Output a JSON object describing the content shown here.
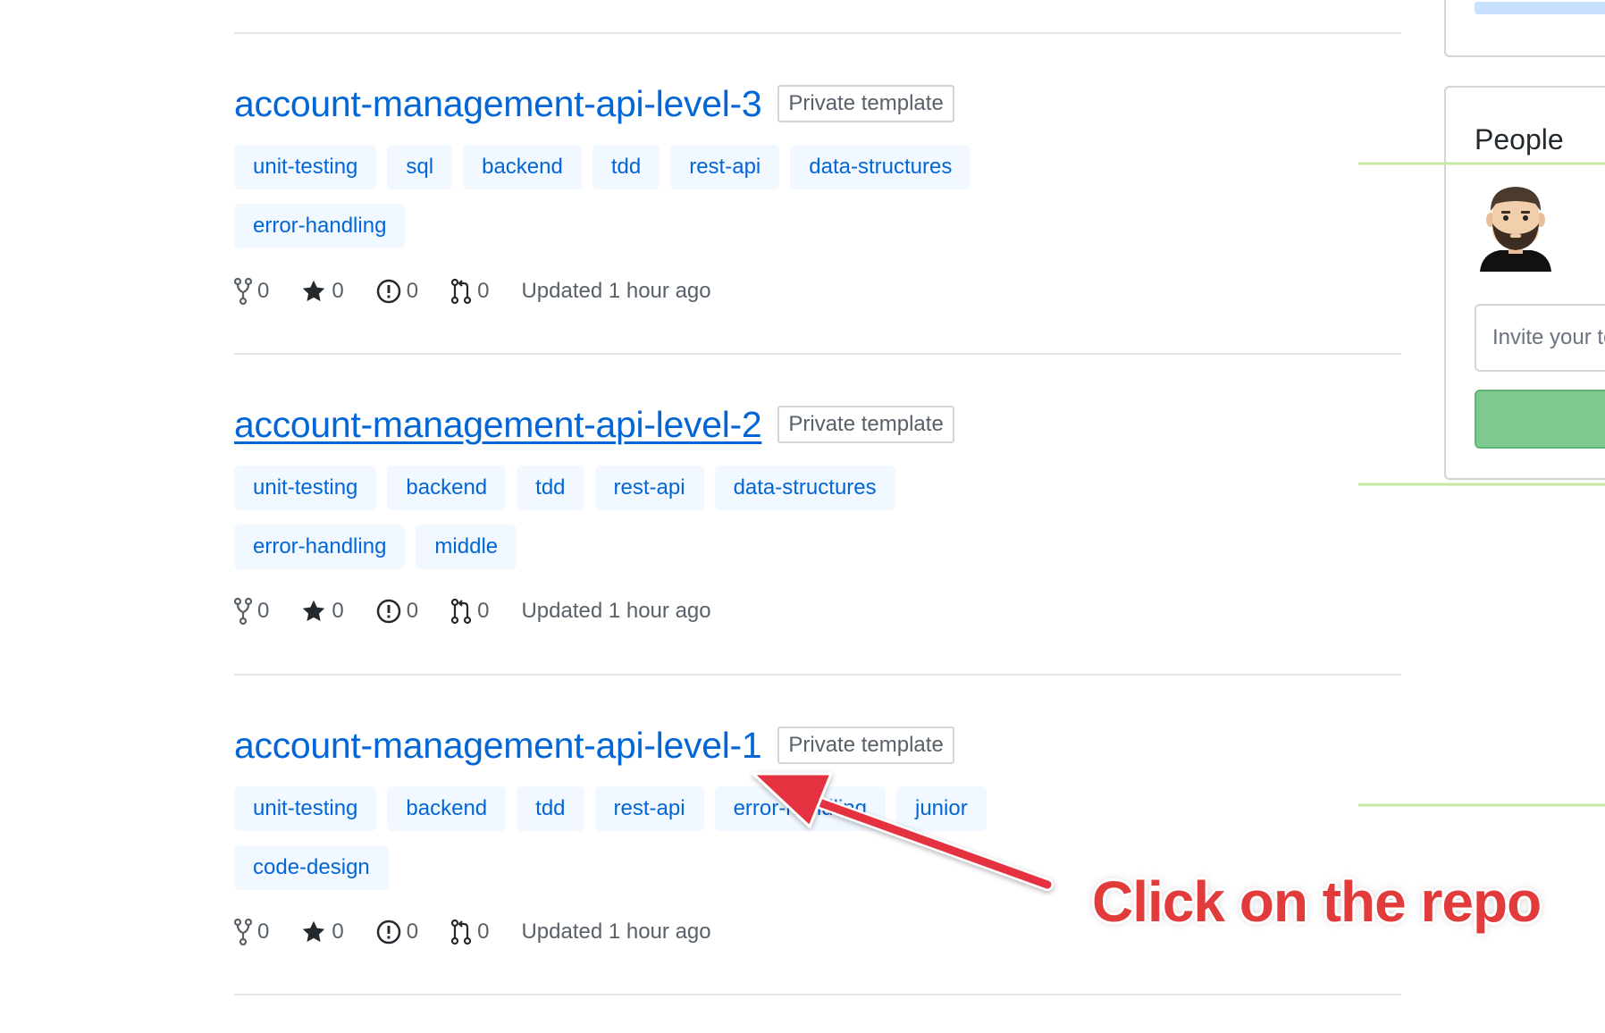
{
  "repos": [
    {
      "name": "account-management-api-level-3",
      "visibility": "Private template",
      "topics": [
        "unit-testing",
        "sql",
        "backend",
        "tdd",
        "rest-api",
        "data-structures",
        "error-handling"
      ],
      "forks": "0",
      "stars": "0",
      "issues": "0",
      "pulls": "0",
      "updated": "Updated 1 hour ago"
    },
    {
      "name": "account-management-api-level-2",
      "visibility": "Private template",
      "topics": [
        "unit-testing",
        "backend",
        "tdd",
        "rest-api",
        "data-structures",
        "error-handling",
        "middle"
      ],
      "forks": "0",
      "stars": "0",
      "issues": "0",
      "pulls": "0",
      "updated": "Updated 1 hour ago"
    },
    {
      "name": "account-management-api-level-1",
      "visibility": "Private template",
      "topics": [
        "unit-testing",
        "backend",
        "tdd",
        "rest-api",
        "error-handling",
        "junior",
        "code-design"
      ],
      "forks": "0",
      "stars": "0",
      "issues": "0",
      "pulls": "0",
      "updated": "Updated 1 hour ago"
    }
  ],
  "sidebar": {
    "people_title": "People",
    "invite_placeholder": "Invite your team"
  },
  "annotation": {
    "text": "Click on the repo",
    "color": "#e23b3b"
  },
  "colors": {
    "link": "#0366d6",
    "topic_bg": "#f1f8ff",
    "sparkline": "#c7e8a0",
    "invite_button": "#7ec98f"
  },
  "icons": [
    "fork-icon",
    "star-icon",
    "issue-icon",
    "pull-request-icon"
  ]
}
